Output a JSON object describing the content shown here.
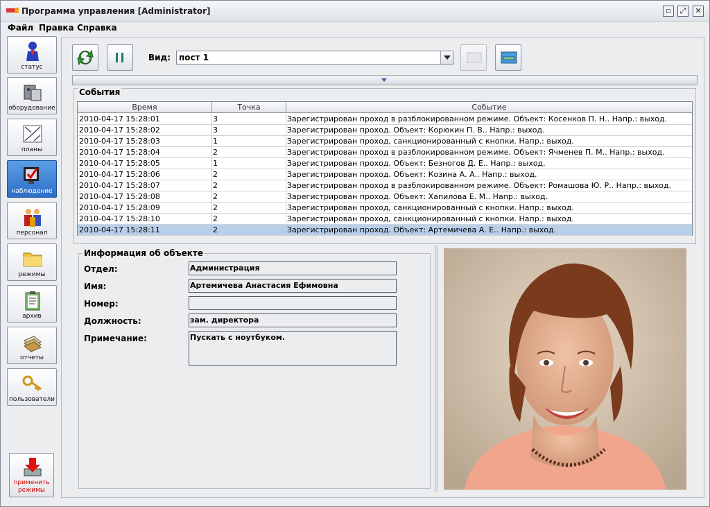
{
  "window": {
    "title": "Программа управления [Administrator]"
  },
  "menu": [
    "Файл",
    "Правка",
    "Справка"
  ],
  "sidebar": {
    "items": [
      {
        "label": "статус",
        "icon": "status-icon"
      },
      {
        "label": "оборудование",
        "icon": "equipment-icon"
      },
      {
        "label": "планы",
        "icon": "plans-icon"
      },
      {
        "label": "наблюдение",
        "icon": "monitoring-icon",
        "active": true
      },
      {
        "label": "персонал",
        "icon": "personnel-icon"
      },
      {
        "label": "режимы",
        "icon": "folder-icon"
      },
      {
        "label": "архив",
        "icon": "clipboard-icon"
      },
      {
        "label": "отчеты",
        "icon": "reports-icon"
      },
      {
        "label": "пользователи",
        "icon": "key-icon"
      }
    ],
    "apply": {
      "label_line1": "применить",
      "label_line2": "режимы"
    }
  },
  "toolbar": {
    "vid_label": "Вид:",
    "vid_value": "пост 1"
  },
  "events": {
    "group_title": "События",
    "columns": [
      "Время",
      "Точка",
      "Событие"
    ],
    "rows": [
      {
        "time": "2010-04-17 15:28:01",
        "point": "3",
        "event": "Зарегистрирован проход в разблокированном режиме. Объект: Косенков П. Н.. Напр.: выход."
      },
      {
        "time": "2010-04-17 15:28:02",
        "point": "3",
        "event": "Зарегистрирован проход. Объект: Корюкин П. В.. Напр.: выход."
      },
      {
        "time": "2010-04-17 15:28:03",
        "point": "1",
        "event": "Зарегистрирован проход, санкционированный с кнопки. Напр.: выход."
      },
      {
        "time": "2010-04-17 15:28:04",
        "point": "2",
        "event": "Зарегистрирован проход в разблокированном режиме. Объект: Ячменев П. М.. Напр.: выход."
      },
      {
        "time": "2010-04-17 15:28:05",
        "point": "1",
        "event": "Зарегистрирован проход. Объект: Безногов Д. Е.. Напр.: выход."
      },
      {
        "time": "2010-04-17 15:28:06",
        "point": "2",
        "event": "Зарегистрирован проход. Объект: Козина А. А.. Напр.: выход."
      },
      {
        "time": "2010-04-17 15:28:07",
        "point": "2",
        "event": "Зарегистрирован проход в разблокированном режиме. Объект: Ромашова Ю. Р.. Напр.: выход."
      },
      {
        "time": "2010-04-17 15:28:08",
        "point": "2",
        "event": "Зарегистрирован проход. Объект: Хапилова Е. М.. Напр.: выход."
      },
      {
        "time": "2010-04-17 15:28:09",
        "point": "2",
        "event": "Зарегистрирован проход, санкционированный с кнопки. Напр.: выход."
      },
      {
        "time": "2010-04-17 15:28:10",
        "point": "2",
        "event": "Зарегистрирован проход, санкционированный с кнопки. Напр.: выход."
      },
      {
        "time": "2010-04-17 15:28:11",
        "point": "2",
        "event": "Зарегистрирован проход. Объект: Артемичева А. Е.. Напр.: выход.",
        "selected": true
      }
    ]
  },
  "info": {
    "group_title": "Информация об объекте",
    "fields": [
      {
        "label": "Отдел:",
        "value": "Администрация"
      },
      {
        "label": "Имя:",
        "value": "Артемичева Анастасия Ефимовна"
      },
      {
        "label": "Номер:",
        "value": ""
      },
      {
        "label": "Должность:",
        "value": "зам. директора"
      },
      {
        "label": "Примечание:",
        "value": "Пускать с ноутбуком."
      }
    ]
  },
  "colors": {
    "selection": "#b8cfe9",
    "active_nav": "#2d6fc7",
    "apply_text": "#d10000"
  }
}
